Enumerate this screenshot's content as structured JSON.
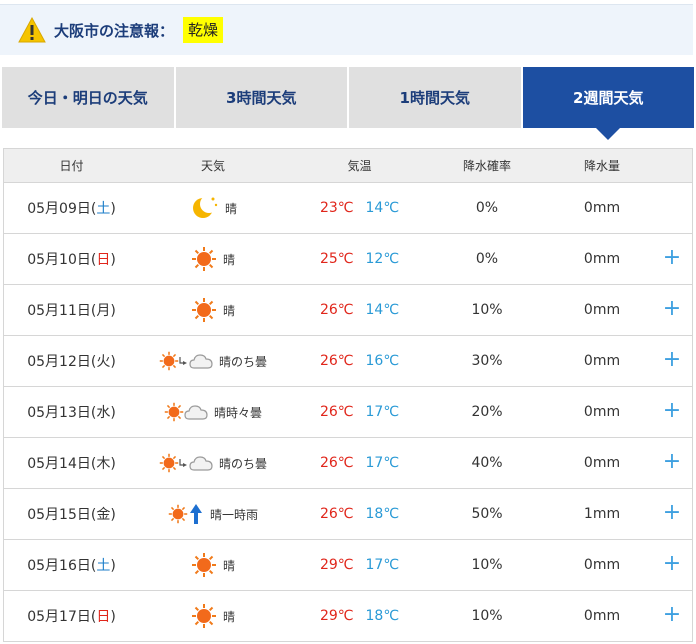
{
  "alert": {
    "label": "大阪市の注意報：",
    "badge": "乾燥"
  },
  "tabs": [
    {
      "label": "今日・明日の天気",
      "active": false
    },
    {
      "label": "3時間天気",
      "active": false
    },
    {
      "label": "1時間天気",
      "active": false
    },
    {
      "label": "2週間天気",
      "active": true
    }
  ],
  "table": {
    "headers": [
      "日付",
      "天気",
      "気温",
      "降水確率",
      "降水量"
    ],
    "rows": [
      {
        "date": "05月09日(",
        "dow": "土",
        "dow_type": "sat",
        "date_end": ")",
        "icon": "moon-icon",
        "weather": "晴",
        "hi": "23℃",
        "lo": "14℃",
        "prob": "0%",
        "amount": "0mm",
        "expand": false
      },
      {
        "date": "05月10日(",
        "dow": "日",
        "dow_type": "sun",
        "date_end": ")",
        "icon": "sun-icon",
        "weather": "晴",
        "hi": "25℃",
        "lo": "12℃",
        "prob": "0%",
        "amount": "0mm",
        "expand": true
      },
      {
        "date": "05月11日(",
        "dow": "月",
        "dow_type": "weekday",
        "date_end": ")",
        "icon": "sun-icon",
        "weather": "晴",
        "hi": "26℃",
        "lo": "14℃",
        "prob": "10%",
        "amount": "0mm",
        "expand": true
      },
      {
        "date": "05月12日(",
        "dow": "火",
        "dow_type": "weekday",
        "date_end": ")",
        "icon": "sun-then-cloud-icon",
        "weather": "晴のち曇",
        "hi": "26℃",
        "lo": "16℃",
        "prob": "30%",
        "amount": "0mm",
        "expand": true
      },
      {
        "date": "05月13日(",
        "dow": "水",
        "dow_type": "weekday",
        "date_end": ")",
        "icon": "sun-sometimes-cloud-icon",
        "weather": "晴時々曇",
        "hi": "26℃",
        "lo": "17℃",
        "prob": "20%",
        "amount": "0mm",
        "expand": true
      },
      {
        "date": "05月14日(",
        "dow": "木",
        "dow_type": "weekday",
        "date_end": ")",
        "icon": "sun-then-cloud-icon",
        "weather": "晴のち曇",
        "hi": "26℃",
        "lo": "17℃",
        "prob": "40%",
        "amount": "0mm",
        "expand": true
      },
      {
        "date": "05月15日(",
        "dow": "金",
        "dow_type": "weekday",
        "date_end": ")",
        "icon": "sun-rain-icon",
        "weather": "晴一時雨",
        "hi": "26℃",
        "lo": "18℃",
        "prob": "50%",
        "amount": "1mm",
        "expand": true
      },
      {
        "date": "05月16日(",
        "dow": "土",
        "dow_type": "sat",
        "date_end": ")",
        "icon": "sun-icon",
        "weather": "晴",
        "hi": "29℃",
        "lo": "17℃",
        "prob": "10%",
        "amount": "0mm",
        "expand": true
      },
      {
        "date": "05月17日(",
        "dow": "日",
        "dow_type": "sun",
        "date_end": ")",
        "icon": "sun-icon",
        "weather": "晴",
        "hi": "29℃",
        "lo": "18℃",
        "prob": "10%",
        "amount": "0mm",
        "expand": true
      }
    ]
  },
  "colors": {
    "accent": "#1d4fa2",
    "hi": "#e0261b",
    "lo": "#2a9ad6",
    "badge": "#ffff00",
    "plus": "#3ea0e0"
  },
  "plus_glyph": "+"
}
